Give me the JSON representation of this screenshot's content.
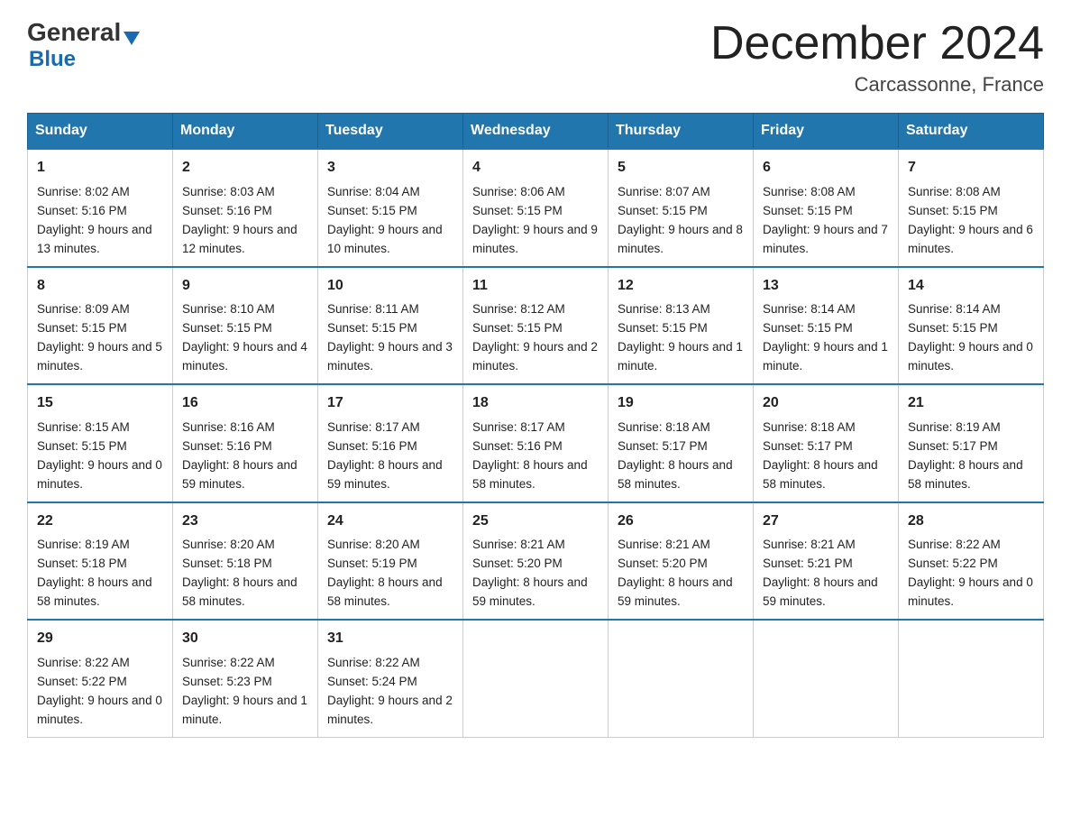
{
  "logo": {
    "general": "General",
    "blue": "Blue"
  },
  "title": "December 2024",
  "subtitle": "Carcassonne, France",
  "days": [
    "Sunday",
    "Monday",
    "Tuesday",
    "Wednesday",
    "Thursday",
    "Friday",
    "Saturday"
  ],
  "weeks": [
    [
      {
        "num": "1",
        "sunrise": "8:02 AM",
        "sunset": "5:16 PM",
        "daylight": "9 hours and 13 minutes."
      },
      {
        "num": "2",
        "sunrise": "8:03 AM",
        "sunset": "5:16 PM",
        "daylight": "9 hours and 12 minutes."
      },
      {
        "num": "3",
        "sunrise": "8:04 AM",
        "sunset": "5:15 PM",
        "daylight": "9 hours and 10 minutes."
      },
      {
        "num": "4",
        "sunrise": "8:06 AM",
        "sunset": "5:15 PM",
        "daylight": "9 hours and 9 minutes."
      },
      {
        "num": "5",
        "sunrise": "8:07 AM",
        "sunset": "5:15 PM",
        "daylight": "9 hours and 8 minutes."
      },
      {
        "num": "6",
        "sunrise": "8:08 AM",
        "sunset": "5:15 PM",
        "daylight": "9 hours and 7 minutes."
      },
      {
        "num": "7",
        "sunrise": "8:08 AM",
        "sunset": "5:15 PM",
        "daylight": "9 hours and 6 minutes."
      }
    ],
    [
      {
        "num": "8",
        "sunrise": "8:09 AM",
        "sunset": "5:15 PM",
        "daylight": "9 hours and 5 minutes."
      },
      {
        "num": "9",
        "sunrise": "8:10 AM",
        "sunset": "5:15 PM",
        "daylight": "9 hours and 4 minutes."
      },
      {
        "num": "10",
        "sunrise": "8:11 AM",
        "sunset": "5:15 PM",
        "daylight": "9 hours and 3 minutes."
      },
      {
        "num": "11",
        "sunrise": "8:12 AM",
        "sunset": "5:15 PM",
        "daylight": "9 hours and 2 minutes."
      },
      {
        "num": "12",
        "sunrise": "8:13 AM",
        "sunset": "5:15 PM",
        "daylight": "9 hours and 1 minute."
      },
      {
        "num": "13",
        "sunrise": "8:14 AM",
        "sunset": "5:15 PM",
        "daylight": "9 hours and 1 minute."
      },
      {
        "num": "14",
        "sunrise": "8:14 AM",
        "sunset": "5:15 PM",
        "daylight": "9 hours and 0 minutes."
      }
    ],
    [
      {
        "num": "15",
        "sunrise": "8:15 AM",
        "sunset": "5:15 PM",
        "daylight": "9 hours and 0 minutes."
      },
      {
        "num": "16",
        "sunrise": "8:16 AM",
        "sunset": "5:16 PM",
        "daylight": "8 hours and 59 minutes."
      },
      {
        "num": "17",
        "sunrise": "8:17 AM",
        "sunset": "5:16 PM",
        "daylight": "8 hours and 59 minutes."
      },
      {
        "num": "18",
        "sunrise": "8:17 AM",
        "sunset": "5:16 PM",
        "daylight": "8 hours and 58 minutes."
      },
      {
        "num": "19",
        "sunrise": "8:18 AM",
        "sunset": "5:17 PM",
        "daylight": "8 hours and 58 minutes."
      },
      {
        "num": "20",
        "sunrise": "8:18 AM",
        "sunset": "5:17 PM",
        "daylight": "8 hours and 58 minutes."
      },
      {
        "num": "21",
        "sunrise": "8:19 AM",
        "sunset": "5:17 PM",
        "daylight": "8 hours and 58 minutes."
      }
    ],
    [
      {
        "num": "22",
        "sunrise": "8:19 AM",
        "sunset": "5:18 PM",
        "daylight": "8 hours and 58 minutes."
      },
      {
        "num": "23",
        "sunrise": "8:20 AM",
        "sunset": "5:18 PM",
        "daylight": "8 hours and 58 minutes."
      },
      {
        "num": "24",
        "sunrise": "8:20 AM",
        "sunset": "5:19 PM",
        "daylight": "8 hours and 58 minutes."
      },
      {
        "num": "25",
        "sunrise": "8:21 AM",
        "sunset": "5:20 PM",
        "daylight": "8 hours and 59 minutes."
      },
      {
        "num": "26",
        "sunrise": "8:21 AM",
        "sunset": "5:20 PM",
        "daylight": "8 hours and 59 minutes."
      },
      {
        "num": "27",
        "sunrise": "8:21 AM",
        "sunset": "5:21 PM",
        "daylight": "8 hours and 59 minutes."
      },
      {
        "num": "28",
        "sunrise": "8:22 AM",
        "sunset": "5:22 PM",
        "daylight": "9 hours and 0 minutes."
      }
    ],
    [
      {
        "num": "29",
        "sunrise": "8:22 AM",
        "sunset": "5:22 PM",
        "daylight": "9 hours and 0 minutes."
      },
      {
        "num": "30",
        "sunrise": "8:22 AM",
        "sunset": "5:23 PM",
        "daylight": "9 hours and 1 minute."
      },
      {
        "num": "31",
        "sunrise": "8:22 AM",
        "sunset": "5:24 PM",
        "daylight": "9 hours and 2 minutes."
      },
      null,
      null,
      null,
      null
    ]
  ]
}
